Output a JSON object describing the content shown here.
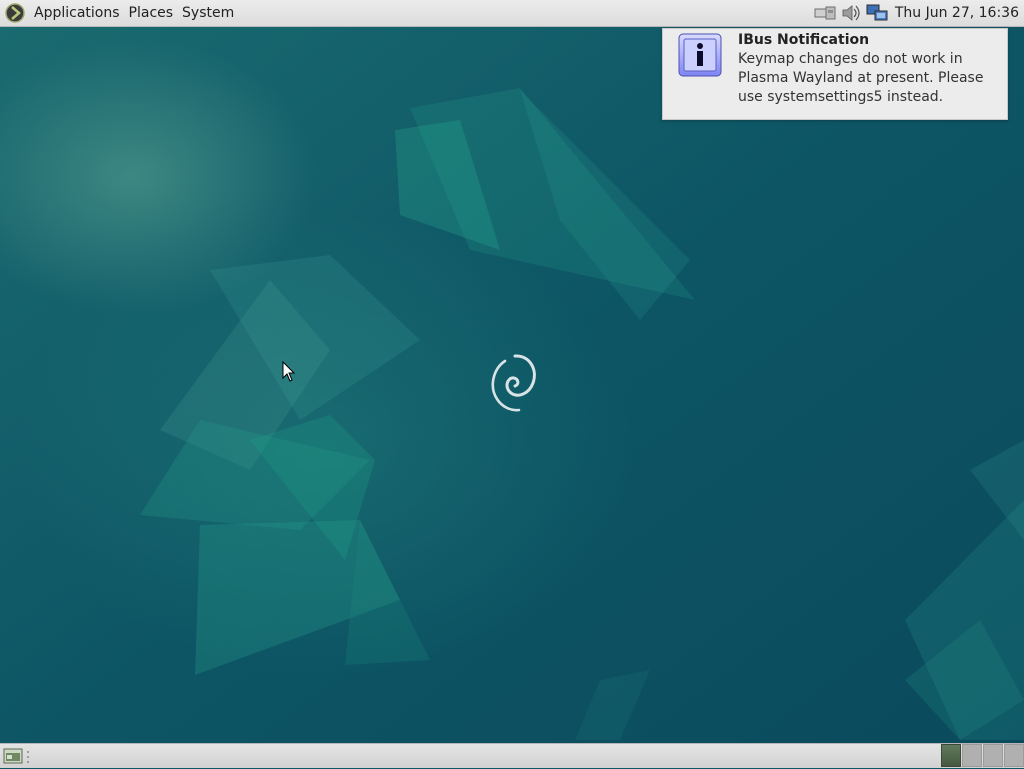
{
  "top_panel": {
    "menus": [
      "Applications",
      "Places",
      "System"
    ],
    "clock": "Thu Jun 27, 16:36",
    "tray_icons": [
      "network-wired-icon",
      "volume-icon",
      "network-display-icon"
    ]
  },
  "notification": {
    "title": "IBus Notification",
    "body": "Keymap changes do not work in Plasma Wayland at present. Please use systemsettings5 instead.",
    "icon": "info-icon"
  },
  "bottom_panel": {
    "workspaces": [
      {
        "active": true
      },
      {
        "active": false
      },
      {
        "active": false
      },
      {
        "active": false
      }
    ]
  },
  "colors": {
    "desktop_background": "#0f5666",
    "panel": "#e6e6e6",
    "notification_background": "#ececec"
  }
}
